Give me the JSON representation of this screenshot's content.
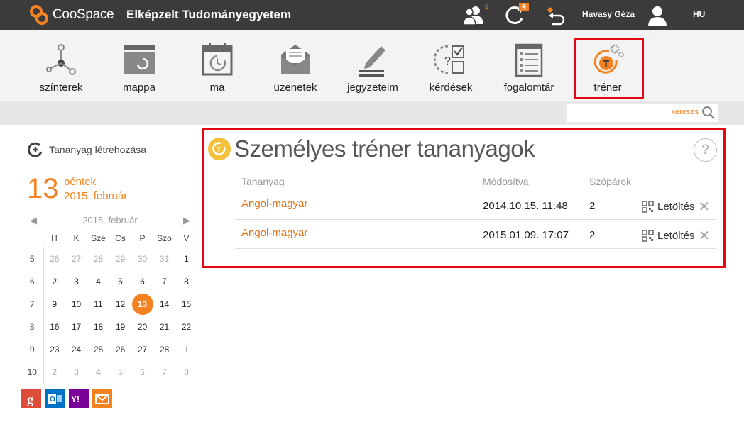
{
  "header": {
    "brand": "CooSpace",
    "institution": "Elképzelt Tudományegyetem",
    "contacts_count": "0",
    "updates_count": "4",
    "user_name": "Havasy Géza",
    "language": "HU"
  },
  "toolbar": {
    "items": [
      {
        "label": "színterek",
        "icon": "network-icon"
      },
      {
        "label": "mappa",
        "icon": "folder-icon"
      },
      {
        "label": "ma",
        "icon": "calendar-clock-icon"
      },
      {
        "label": "üzenetek",
        "icon": "envelope-icon"
      },
      {
        "label": "jegyzeteim",
        "icon": "pencil-notes-icon"
      },
      {
        "label": "kérdések",
        "icon": "question-checklist-icon"
      },
      {
        "label": "fogalomtár",
        "icon": "glossary-list-icon"
      },
      {
        "label": "tréner",
        "icon": "trainer-icon"
      }
    ]
  },
  "search": {
    "placeholder": "keresés"
  },
  "sidebar": {
    "create_label": "Tananyag létrehozása",
    "big_day": "13",
    "weekday": "péntek",
    "date": "2015. február",
    "calendar": {
      "month_label": "2015. február",
      "headers": [
        "H",
        "K",
        "Sze",
        "Cs",
        "P",
        "Szo",
        "V"
      ],
      "weeks": [
        {
          "wk": "5",
          "days": [
            "26",
            "27",
            "28",
            "29",
            "30",
            "31",
            "1"
          ]
        },
        {
          "wk": "6",
          "days": [
            "2",
            "3",
            "4",
            "5",
            "6",
            "7",
            "8"
          ]
        },
        {
          "wk": "7",
          "days": [
            "9",
            "10",
            "11",
            "12",
            "13",
            "14",
            "15"
          ]
        },
        {
          "wk": "8",
          "days": [
            "16",
            "17",
            "18",
            "19",
            "20",
            "21",
            "22"
          ]
        },
        {
          "wk": "9",
          "days": [
            "23",
            "24",
            "25",
            "26",
            "27",
            "28",
            "1"
          ]
        },
        {
          "wk": "10",
          "days": [
            "2",
            "3",
            "4",
            "5",
            "6",
            "7",
            "8"
          ]
        }
      ]
    }
  },
  "main": {
    "title": "Személyes tréner tananyagok",
    "help": "?",
    "columns": [
      "Tananyag",
      "Módosítva",
      "Szópárok"
    ],
    "rows": [
      {
        "name": "Angol-magyar",
        "modified": "2014.10.15. 11:48",
        "pairs": "2",
        "download": "Letöltés"
      },
      {
        "name": "Angol-magyar",
        "modified": "2015.01.09. 17:07",
        "pairs": "2",
        "download": "Letöltés"
      }
    ]
  },
  "colors": {
    "accent": "#f58220",
    "highlight": "#e30613",
    "topbar": "#3b3b3b"
  }
}
